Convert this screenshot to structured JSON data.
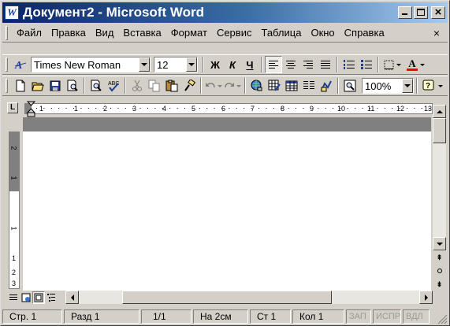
{
  "window": {
    "title": "Документ2 - Microsoft Word",
    "app_icon_letter": "W",
    "minimize_glyph": "_",
    "maximize_glyph": "□",
    "close_glyph": "×"
  },
  "menu": {
    "items": [
      "Файл",
      "Правка",
      "Вид",
      "Вставка",
      "Формат",
      "Сервис",
      "Таблица",
      "Окно",
      "Справка"
    ],
    "close_glyph": "×"
  },
  "formatting_toolbar": {
    "style_icon": "style-icon",
    "font_name": "Times New Roman",
    "font_size": "12",
    "bold_label": "Ж",
    "italic_label": "К",
    "underline_label": "Ч",
    "font_color_label": "A",
    "font_color": "#ff0000",
    "icons": [
      "style-icon",
      "bold-icon",
      "italic-icon",
      "underline-icon",
      "align-left-icon",
      "align-center-icon",
      "align-right-icon",
      "justify-icon",
      "numbered-list-icon",
      "bulleted-list-icon",
      "border-icon",
      "font-color-icon"
    ]
  },
  "standard_toolbar": {
    "zoom": "100%",
    "icons": [
      "new-document-icon",
      "open-folder-icon",
      "save-icon",
      "print-preview-icon",
      "spell-check-icon",
      "cut-icon",
      "copy-icon",
      "paste-icon",
      "format-painter-icon",
      "undo-icon",
      "redo-icon",
      "hyperlink-icon",
      "tables-borders-icon",
      "insert-table-icon",
      "drawing-icon",
      "document-map-icon",
      "help-icon"
    ]
  },
  "ruler": {
    "corner_label": "L",
    "numbers": [
      "1",
      "1",
      "2",
      "3",
      "4",
      "5",
      "6",
      "7",
      "8",
      "9",
      "10",
      "11",
      "12",
      "13"
    ],
    "vertical_numbers": [
      "2",
      "1",
      "1",
      "1",
      "2",
      "3"
    ]
  },
  "status": {
    "page": "Стр. 1",
    "section": "Разд 1",
    "page_of": "1/1",
    "position": "На 2см",
    "line": "Ст 1",
    "column": "Кол 1",
    "rec": "ЗАП",
    "trk": "ИСПР",
    "ext": "ВДЛ"
  }
}
